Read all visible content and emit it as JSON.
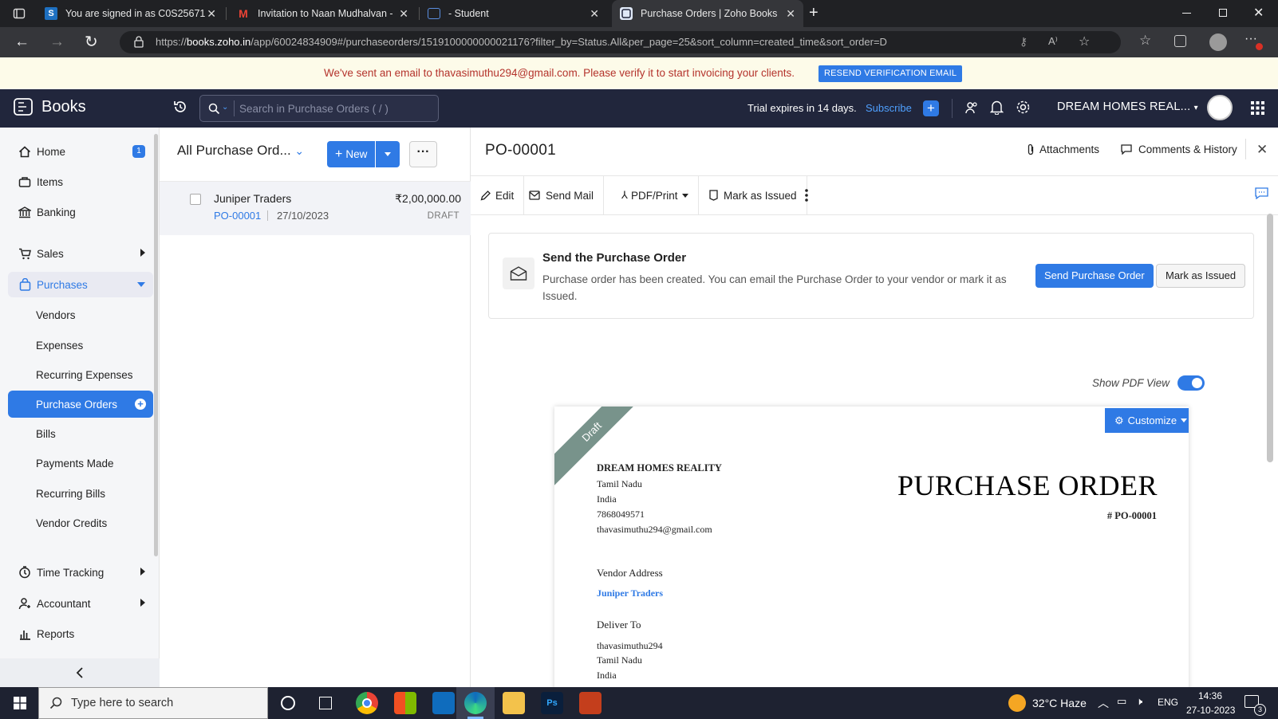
{
  "browser": {
    "tabs": [
      {
        "title": "You are signed in as C0S25671",
        "icon": "s-favicon"
      },
      {
        "title": "Invitation to Naan Mudhalvan - ",
        "icon": "gmail-favicon"
      },
      {
        "title": "- Student",
        "icon": "student-favicon"
      },
      {
        "title": "Purchase Orders | Zoho Books",
        "icon": "zoho-books-favicon",
        "active": true
      }
    ],
    "url_prefix": "https://",
    "url_host": "books.zoho.in",
    "url_path": "/app/60024834909#/purchaseorders/1519100000000021176?filter_by=Status.All&per_page=25&sort_column=created_time&sort_order=D"
  },
  "notice": {
    "text": "We've sent an email to thavasimuthu294@gmail.com. Please verify it to start invoicing your clients.",
    "button": "RESEND VERIFICATION EMAIL"
  },
  "header": {
    "brand": "Books",
    "search_placeholder": "Search in Purchase Orders ( / )",
    "trial": "Trial expires in 14 days.",
    "subscribe": "Subscribe",
    "org": "DREAM HOMES REAL..."
  },
  "sidebar": {
    "items": [
      {
        "label": "Home",
        "icon": "home-icon",
        "badge": "1"
      },
      {
        "label": "Items",
        "icon": "items-icon"
      },
      {
        "label": "Banking",
        "icon": "bank-icon"
      },
      {
        "label": "Sales",
        "icon": "cart-icon"
      },
      {
        "label": "Purchases",
        "icon": "bag-icon"
      },
      {
        "label": "Vendors"
      },
      {
        "label": "Expenses"
      },
      {
        "label": "Recurring Expenses"
      },
      {
        "label": "Purchase Orders"
      },
      {
        "label": "Bills"
      },
      {
        "label": "Payments Made"
      },
      {
        "label": "Recurring Bills"
      },
      {
        "label": "Vendor Credits"
      },
      {
        "label": "Time Tracking",
        "icon": "clock-icon"
      },
      {
        "label": "Accountant",
        "icon": "accountant-icon"
      },
      {
        "label": "Reports",
        "icon": "reports-icon"
      }
    ]
  },
  "list": {
    "title": "All Purchase Ord...",
    "new_label": "New",
    "rows": [
      {
        "vendor": "Juniper Traders",
        "amount": "₹2,00,000.00",
        "po": "PO-00001",
        "date": "27/10/2023",
        "status": "DRAFT"
      }
    ]
  },
  "detail": {
    "title": "PO-00001",
    "attachments": "Attachments",
    "comments": "Comments & History",
    "toolbar": {
      "edit": "Edit",
      "send_mail": "Send Mail",
      "pdf_print": "PDF/Print",
      "mark_issued": "Mark as Issued"
    },
    "send_card": {
      "heading": "Send the Purchase Order",
      "body_line1": "Purchase order has been created. You can email the Purchase Order to your vendor or mark it as",
      "body_line2": "Issued.",
      "primary": "Send Purchase Order",
      "secondary": "Mark as Issued"
    },
    "show_pdf_view": "Show PDF View",
    "customize": "Customize",
    "pdf": {
      "ribbon": "Draft",
      "company": "DREAM HOMES REALITY",
      "company_lines": [
        "Tamil Nadu",
        "India",
        "7868049571",
        "thavasimuthu294@gmail.com"
      ],
      "heading": "PURCHASE ORDER",
      "number": "# PO-00001",
      "vendor_label": "Vendor Address",
      "vendor_name": "Juniper Traders",
      "deliver_label": "Deliver To",
      "deliver_lines": [
        "thavasimuthu294",
        "Tamil Nadu",
        "India"
      ]
    }
  },
  "taskbar": {
    "search_placeholder": "Type here to search",
    "weather": "32°C  Haze",
    "lang": "ENG",
    "time": "14:36",
    "date": "27-10-2023",
    "notif_count": "3"
  },
  "colors": {
    "accent": "#2f7ae5",
    "header_bg": "#21263c",
    "notice_text": "#b4332c"
  }
}
